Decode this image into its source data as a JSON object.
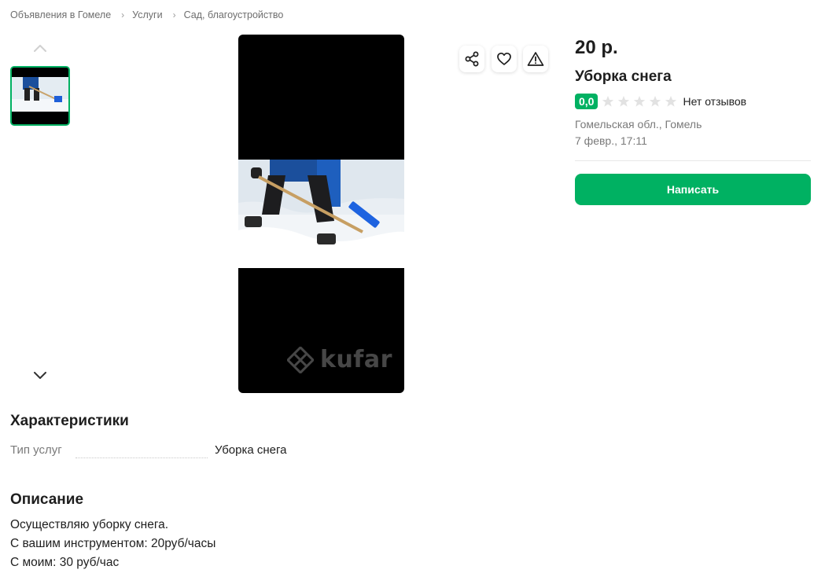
{
  "breadcrumb": {
    "items": [
      "Объявления в Гомеле",
      "Услуги",
      "Сад, благоустройство"
    ],
    "separator": "›"
  },
  "gallery": {
    "thumbnails_count": 1,
    "watermark_text": "kufar"
  },
  "actions": {
    "share_icon": "share-icon",
    "favorite_icon": "heart-icon",
    "report_icon": "warning-icon"
  },
  "listing": {
    "price": "20 р.",
    "title": "Уборка снега",
    "rating": "0,0",
    "stars_filled": 0,
    "stars_total": 5,
    "reviews": "Нет отзывов",
    "location": "Гомельская обл., Гомель",
    "date": "7 февр., 17:11",
    "write_button": "Написать"
  },
  "characteristics": {
    "heading": "Характеристики",
    "rows": [
      {
        "label": "Тип услуг",
        "value": "Уборка снега"
      }
    ]
  },
  "description": {
    "heading": "Описание",
    "lines": [
      "Осуществляю уборку снега.",
      "С вашим инструментом: 20руб/часы",
      "С моим: 30 руб/час"
    ]
  },
  "colors": {
    "accent": "#00b162",
    "text": "#1e1e1e",
    "muted": "#7a7a7a"
  }
}
